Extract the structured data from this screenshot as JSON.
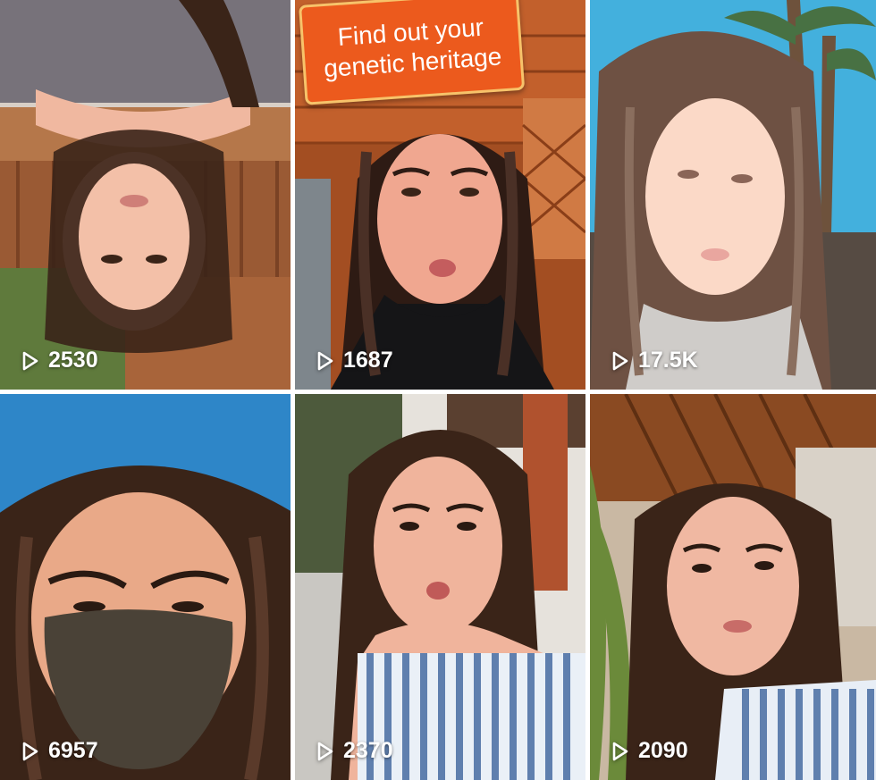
{
  "grid": {
    "tiles": [
      {
        "views": "2530"
      },
      {
        "views": "1687",
        "overlay_text": "Find out your\ngenetic heritage"
      },
      {
        "views": "17.5K"
      },
      {
        "views": "6957"
      },
      {
        "views": "2370"
      },
      {
        "views": "2090"
      }
    ]
  },
  "colors": {
    "view_count_text": "#ffffff",
    "banner_fill": "#ec5a1d",
    "banner_border": "#f7c36a"
  },
  "icons": {
    "view_count": "play-outline-icon"
  }
}
